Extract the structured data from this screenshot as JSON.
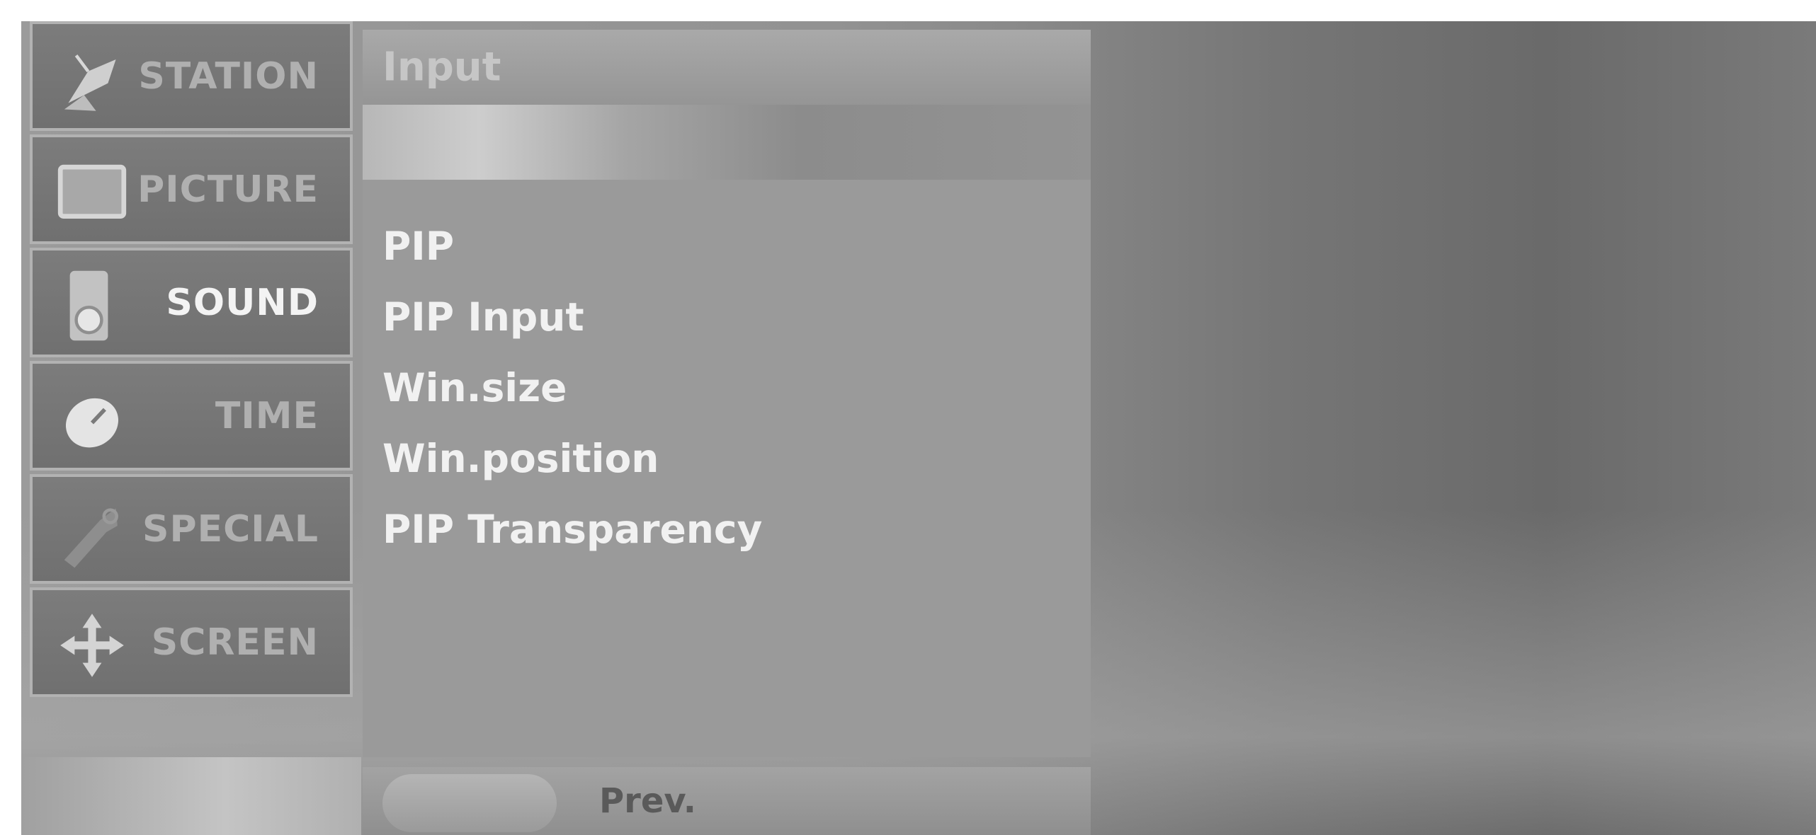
{
  "sidebar": {
    "items": [
      {
        "label": "STATION",
        "icon": "satellite-dish-icon"
      },
      {
        "label": "PICTURE",
        "icon": "tv-screen-icon"
      },
      {
        "label": "SOUND",
        "icon": "speaker-icon"
      },
      {
        "label": "TIME",
        "icon": "clock-icon"
      },
      {
        "label": "SPECIAL",
        "icon": "tag-icon"
      },
      {
        "label": "SCREEN",
        "icon": "move-arrows-icon"
      }
    ],
    "active_item": "SOUND"
  },
  "panel": {
    "title": "Input",
    "items": [
      "PIP",
      "PIP Input",
      "Win.size",
      "Win.position",
      "PIP Transparency"
    ]
  },
  "footer": {
    "prev_label": "Prev."
  }
}
